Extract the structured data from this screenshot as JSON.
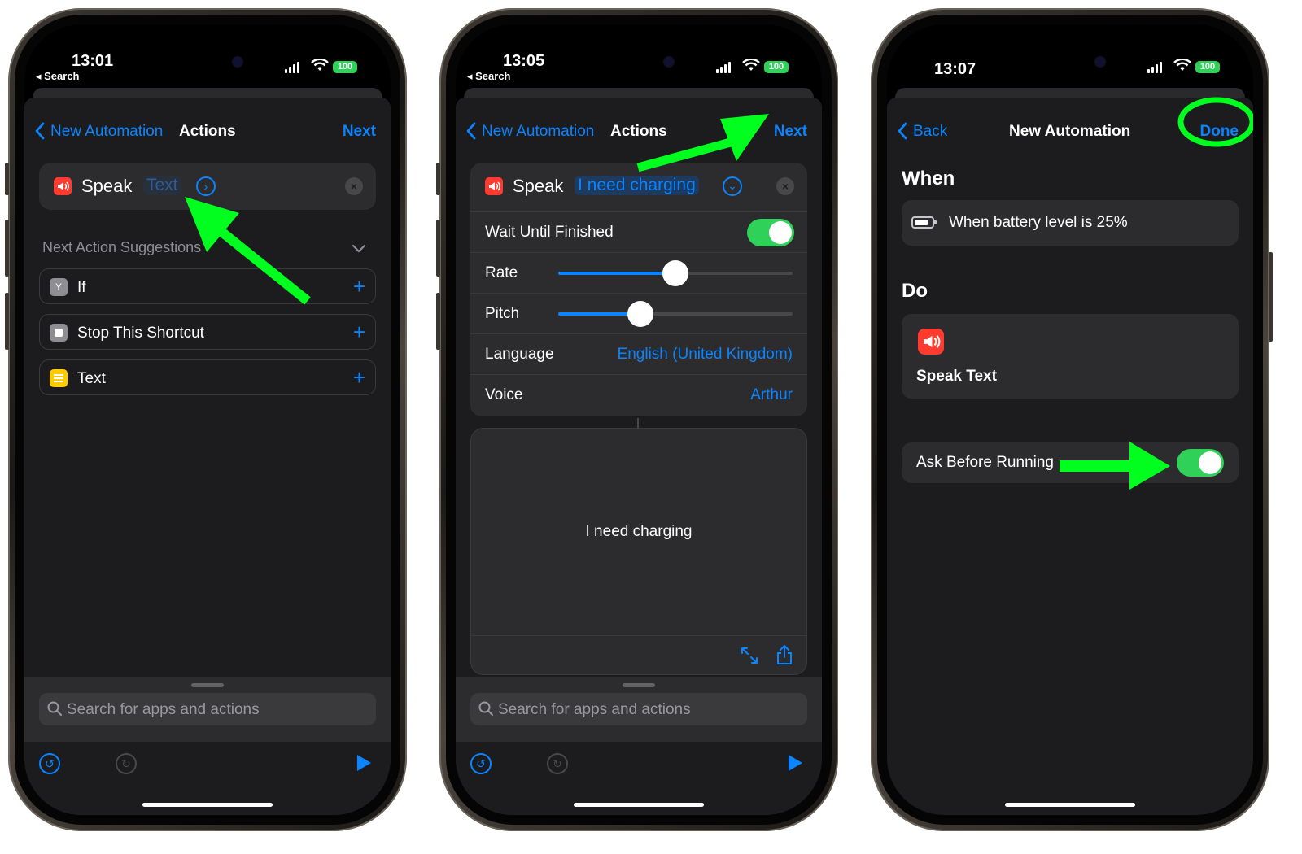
{
  "phone1": {
    "status": {
      "time": "13:01",
      "back_app": "◂ Search",
      "battery": "100"
    },
    "nav": {
      "back": "New Automation",
      "title": "Actions",
      "next": "Next"
    },
    "action": {
      "verb": "Speak",
      "token": "Text"
    },
    "suggestions_header": "Next Action Suggestions",
    "suggestions": [
      {
        "label": "If",
        "icon": "if-icon"
      },
      {
        "label": "Stop This Shortcut",
        "icon": "stop-icon"
      },
      {
        "label": "Text",
        "icon": "text-icon"
      }
    ],
    "search_placeholder": "Search for apps and actions"
  },
  "phone2": {
    "status": {
      "time": "13:05",
      "back_app": "◂ Search",
      "battery": "100"
    },
    "nav": {
      "back": "New Automation",
      "title": "Actions",
      "next": "Next"
    },
    "action": {
      "verb": "Speak",
      "token": "I need charging"
    },
    "params": {
      "wait_label": "Wait Until Finished",
      "wait_on": true,
      "rate_label": "Rate",
      "rate_level": 0.5,
      "pitch_label": "Pitch",
      "pitch_level": 0.35,
      "language_label": "Language",
      "language_value": "English (United Kingdom)",
      "voice_label": "Voice",
      "voice_value": "Arthur"
    },
    "text_content": "I need charging",
    "search_placeholder": "Search for apps and actions"
  },
  "phone3": {
    "status": {
      "time": "13:07",
      "battery": "100"
    },
    "nav": {
      "back": "Back",
      "title": "New Automation",
      "done": "Done"
    },
    "when_header": "When",
    "when_value": "When battery level is 25%",
    "do_header": "Do",
    "do_action": "Speak Text",
    "ask_label": "Ask Before Running",
    "ask_on": true
  },
  "colors": {
    "accent": "#0a84ff",
    "annotation_green": "#00ff1e",
    "toggle_green": "#30d158",
    "speak_red": "#ff3b30"
  }
}
